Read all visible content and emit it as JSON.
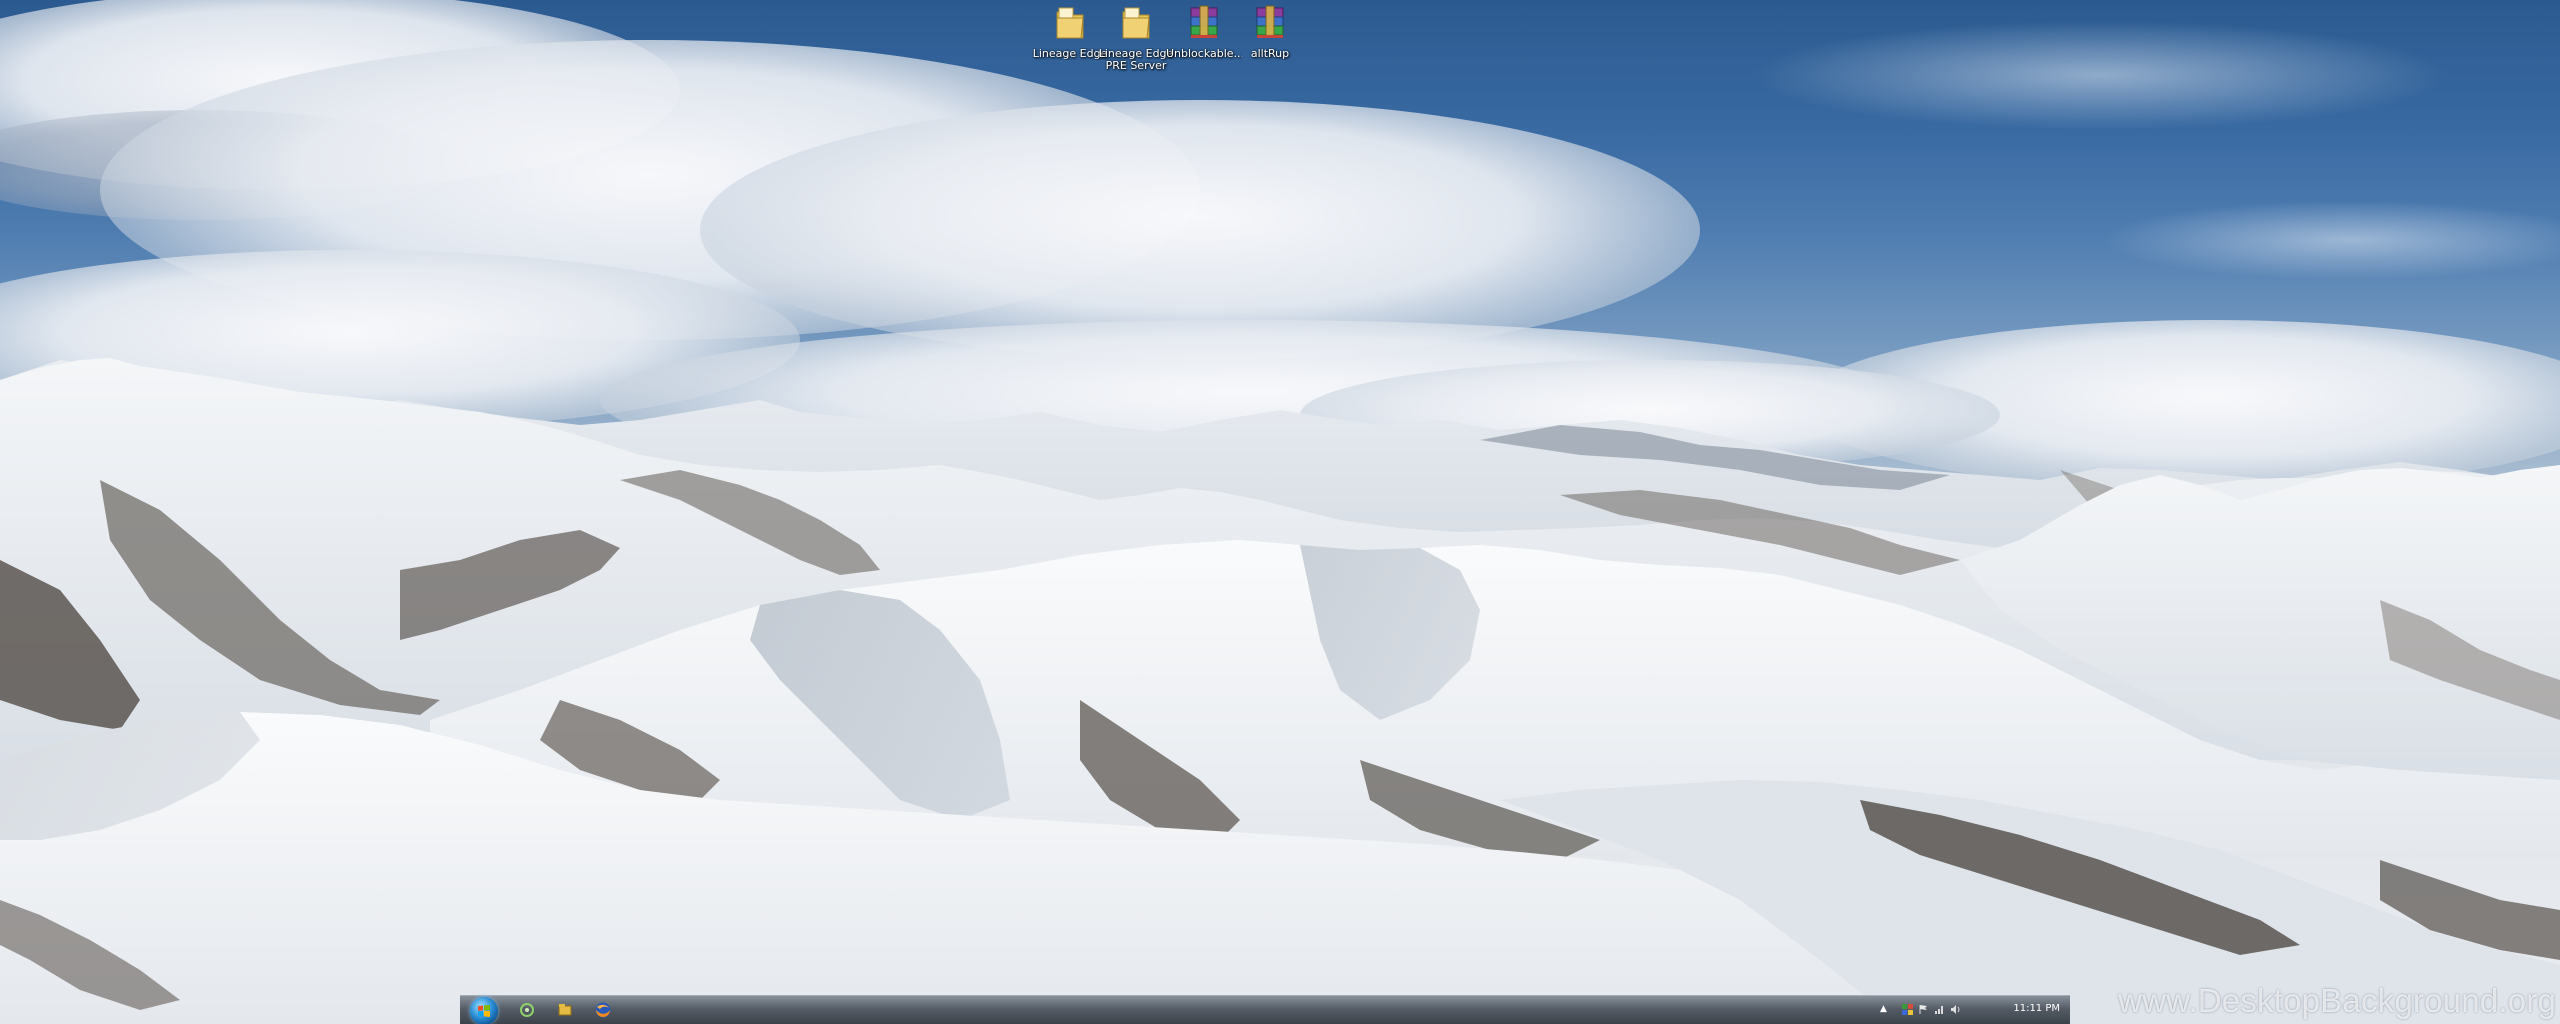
{
  "desktop": {
    "icons": [
      {
        "label": "Lineage Edge",
        "type": "folder"
      },
      {
        "label": "Lineage Edge\nPRE Server",
        "type": "folder"
      },
      {
        "label": "Unblockable...",
        "type": "archive"
      },
      {
        "label": "alltRup",
        "type": "archive"
      }
    ]
  },
  "taskbar": {
    "clock": "11:11 PM",
    "pinned": [
      {
        "name": "start-button"
      },
      {
        "name": "pinned-app-1"
      },
      {
        "name": "pinned-app-2"
      },
      {
        "name": "firefox"
      }
    ]
  },
  "watermark": {
    "text": "www.DesktopBackground.org"
  },
  "colors": {
    "sky_top": "#2b5a90",
    "snow": "#f2f4f7",
    "rock": "#4a4440",
    "taskbar": "#464e58"
  }
}
